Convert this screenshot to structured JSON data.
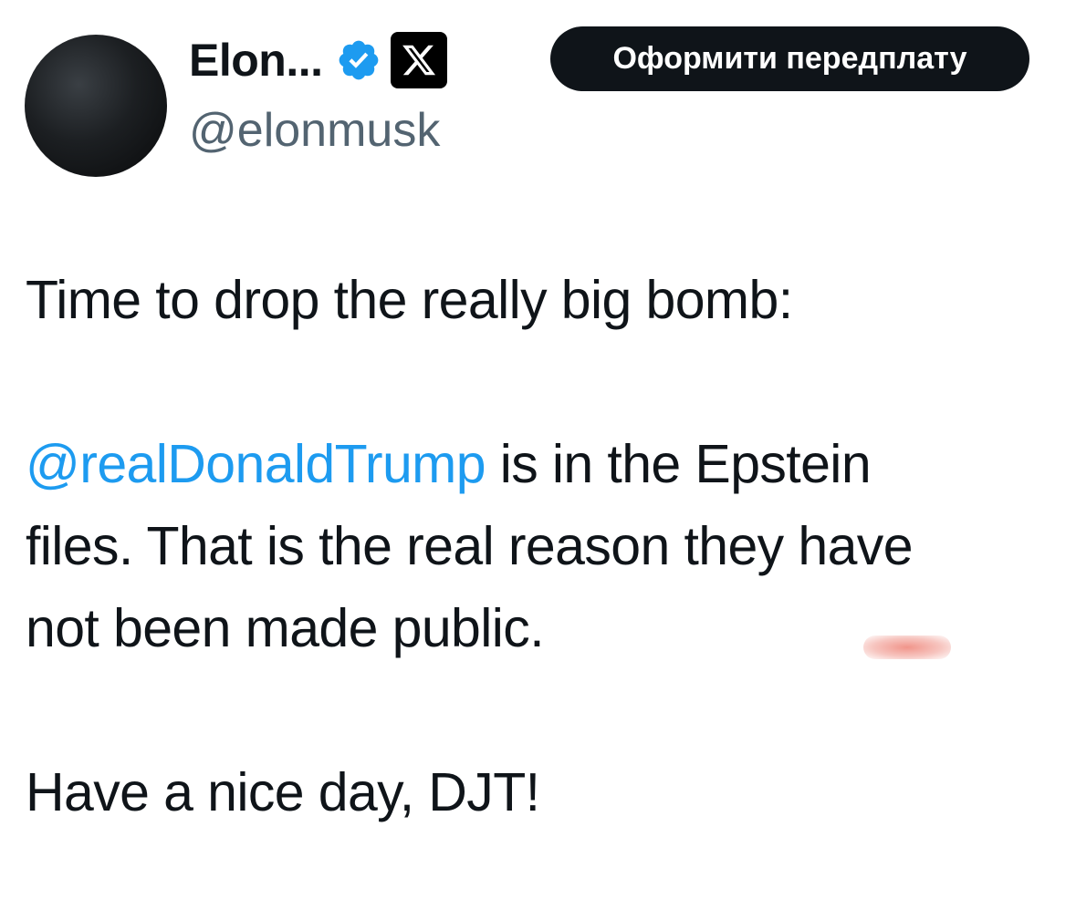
{
  "profile": {
    "display_name": "Elon...",
    "handle": "@elonmusk",
    "verified_icon": "verified-badge-icon",
    "affiliate_icon": "x-logo-icon",
    "colors": {
      "verified_blue": "#1d9bf0",
      "handle_gray": "#536471"
    }
  },
  "subscribe_button": {
    "label": "Оформити передплату",
    "background": "#0f1419"
  },
  "tweet": {
    "line1": "Time to drop the really big bomb:",
    "mention": "@realDonaldTrump",
    "line2_rest": " is in the Epstein",
    "line3": "files. That is the real reason they have",
    "line4": "not been made public.",
    "line5": "Have a nice day, DJT!"
  }
}
